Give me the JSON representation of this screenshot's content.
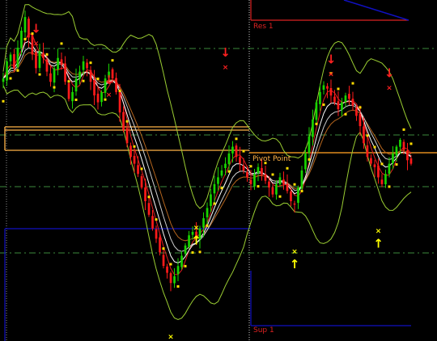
{
  "chart_data": {
    "type": "candlestick",
    "title": "",
    "xlabel": "",
    "ylabel": "",
    "grid": false,
    "ylim": [
      0,
      100
    ],
    "colors": {
      "background": "#000000",
      "bull_candle": "#19d400",
      "bear_candle": "#ff1a1a",
      "bollinger_bands": "#9acd32",
      "white_ma": "#ffffff",
      "brown_ma": "#b5651d",
      "red_ma": "#e02020",
      "dotted_level": "#3b8a3b",
      "orange_level": "#ffb347",
      "pivot_line": "#e08a1e",
      "res_sup_frame": "#dd2222",
      "blue_line": "#1010c0",
      "yellow": "#ffff00",
      "down_arrow": "#ff2020",
      "dot_marker": "#ffdd00"
    },
    "levels": [
      {
        "name": "Res 1",
        "value": 95.9
      },
      {
        "name": "Pivot Point",
        "value": 54.7
      },
      {
        "name": "Sup 1",
        "value": 4.4
      }
    ],
    "horizontal_lines": [
      86.1,
      61.0,
      60.0,
      43.3,
      24.8
    ],
    "closes": [
      77,
      82,
      84,
      80,
      86,
      91,
      95,
      89,
      84,
      80,
      85,
      83,
      79,
      76,
      80,
      83,
      81,
      76,
      71,
      73,
      77,
      79,
      82,
      80,
      76,
      72,
      70,
      73,
      77,
      79,
      77,
      73,
      67,
      62,
      58,
      54,
      52,
      49,
      45,
      41,
      37,
      33,
      30,
      26,
      22,
      20,
      17,
      19,
      22,
      25,
      28,
      31,
      32,
      30,
      33,
      36,
      39,
      43,
      46,
      48,
      50,
      52,
      55,
      57,
      54,
      52,
      50,
      48,
      46,
      49,
      51,
      49,
      47,
      45,
      43,
      46,
      48,
      46,
      44,
      41,
      40,
      45,
      50,
      55,
      60,
      65,
      70,
      73,
      75,
      74,
      72,
      70,
      68,
      70,
      72,
      71,
      69,
      66,
      63,
      58,
      54,
      52,
      51,
      48,
      46,
      49,
      52,
      55,
      57,
      59,
      56,
      53,
      52
    ],
    "down_markers": [
      {
        "label": "↓",
        "value": 88
      },
      {
        "label": "↓",
        "value": 73
      },
      {
        "label": "↓",
        "value": 81
      },
      {
        "label": "↓",
        "value": 79
      },
      {
        "label": "↓",
        "value": 75
      }
    ],
    "up_markers": [
      {
        "label": "↑",
        "value": 2
      },
      {
        "label": "↑",
        "value": 34
      },
      {
        "label": "↑",
        "value": 27
      },
      {
        "label": "↑",
        "value": 33
      }
    ]
  }
}
